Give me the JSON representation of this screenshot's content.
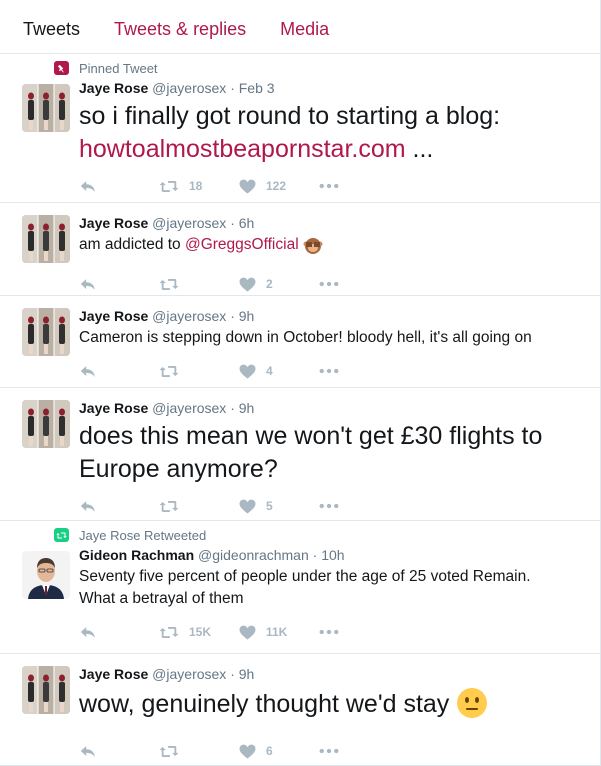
{
  "tabs": [
    {
      "label": "Tweets"
    },
    {
      "label": "Tweets & replies"
    },
    {
      "label": "Media"
    }
  ],
  "colors": {
    "accent": "#b0184c",
    "pinned_icon": "#b0184c",
    "retweet_icon": "#19cf86",
    "muted": "#657786",
    "action_icon": "#aab8c2",
    "border": "#e1e8ed"
  },
  "tweets": [
    {
      "context": "Pinned Tweet",
      "context_icon": "pin-icon",
      "name": "Jaye Rose",
      "handle": "@jayerosex",
      "time": "· Feb 3",
      "text": "so i finally got round to starting a blog:",
      "link": "howtoalmostbeapornstar.com",
      "link_suffix": " ...",
      "retweets": "18",
      "likes": "122"
    },
    {
      "name": "Jaye Rose",
      "handle": "@jayerosex",
      "time": "· 6h",
      "text": "am addicted to ",
      "mention": "@GreggsOfficial",
      "emoji": "see-no-evil-monkey-icon",
      "retweets": "",
      "likes": "2"
    },
    {
      "name": "Jaye Rose",
      "handle": "@jayerosex",
      "time": "· 9h",
      "text": "Cameron is stepping down in October! bloody hell, it's all going on",
      "retweets": "",
      "likes": "4"
    },
    {
      "name": "Jaye Rose",
      "handle": "@jayerosex",
      "time": "· 9h",
      "text_line1": "does this mean we won't get £30 flights to",
      "text_line2": "Europe anymore?",
      "retweets": "",
      "likes": "5"
    },
    {
      "context": "Jaye Rose Retweeted",
      "context_icon": "retweet-icon",
      "name": "Gideon Rachman",
      "handle": "@gideonrachman",
      "time": "· 10h",
      "text_line1": "Seventy five percent of people under the age of 25 voted Remain.",
      "text_line2": "What a betrayal of them",
      "retweets": "15K",
      "likes": "11K"
    },
    {
      "name": "Jaye Rose",
      "handle": "@jayerosex",
      "time": "· 9h",
      "text": "wow, genuinely thought we'd stay",
      "emoji": "neutral-face-icon",
      "retweets": "",
      "likes": "6"
    }
  ]
}
